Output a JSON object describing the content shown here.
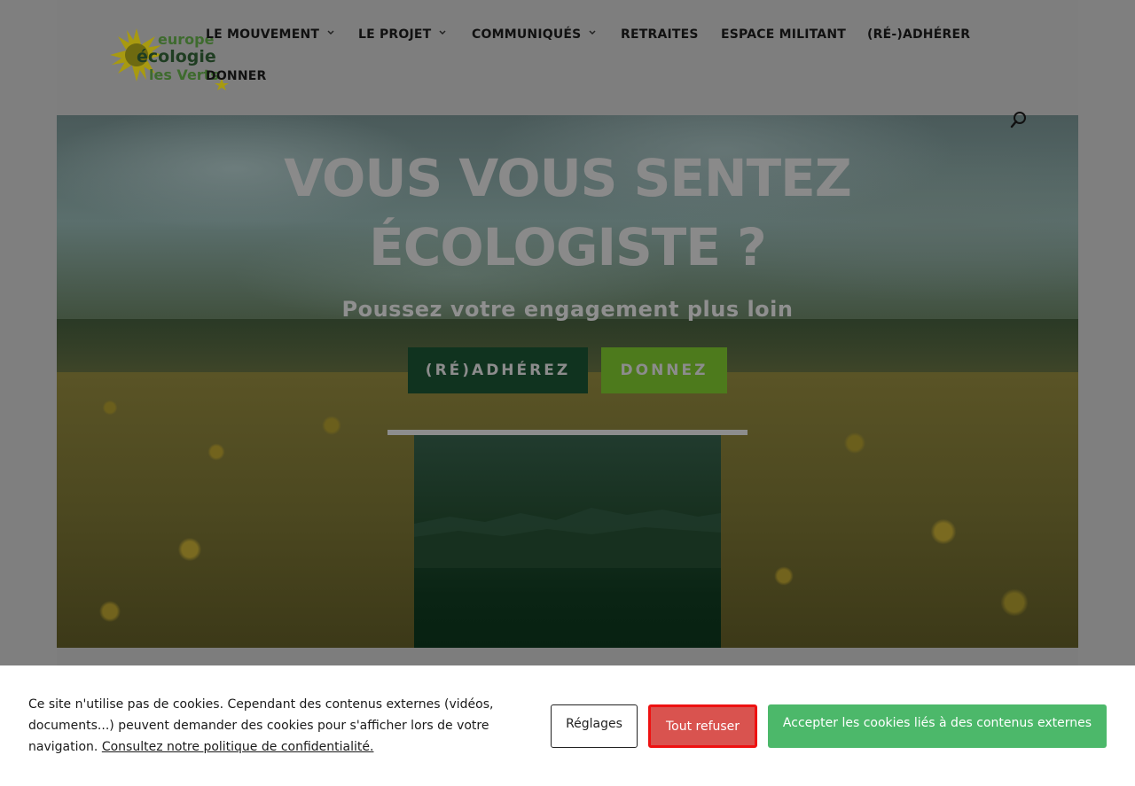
{
  "header": {
    "logo_text_lines": [
      "europe",
      "écologie",
      "les Verts"
    ],
    "nav": [
      {
        "label": "LE MOUVEMENT",
        "has_dropdown": true
      },
      {
        "label": "LE PROJET",
        "has_dropdown": true
      },
      {
        "label": "COMMUNIQUÉS",
        "has_dropdown": true
      },
      {
        "label": "RETRAITES",
        "has_dropdown": false
      },
      {
        "label": "ESPACE MILITANT",
        "has_dropdown": false
      },
      {
        "label": "(RÉ-)ADHÉRER",
        "has_dropdown": false
      },
      {
        "label": "DONNER",
        "has_dropdown": false
      }
    ],
    "chevron_glyph": "⌄",
    "search_icon": "search-icon"
  },
  "hero": {
    "title_line1": "VOUS VOUS SENTEZ",
    "title_line2": "ÉCOLOGISTE ?",
    "subtitle": "Poussez votre engagement plus loin",
    "btn_adherez": "(RÉ)ADHÉREZ",
    "btn_donnez": "DONNEZ"
  },
  "cookie": {
    "text": "Ce site n'utilise pas de cookies. Cependant des contenus externes (vidéos, documents...) peuvent demander des cookies pour s'afficher lors de votre navigation.",
    "policy_link": "Consultez notre politique de confidentialité.",
    "settings_label": "Réglages",
    "refuse_label": "Tout refuser",
    "accept_label": "Accepter les cookies liés à des contenus externes"
  },
  "colors": {
    "brand_green": "#4cb86a",
    "refuse_red": "#d9534f",
    "dark_green": "#10331f",
    "light_green": "#4d7a1c",
    "logo_yellow": "#c9b800"
  }
}
